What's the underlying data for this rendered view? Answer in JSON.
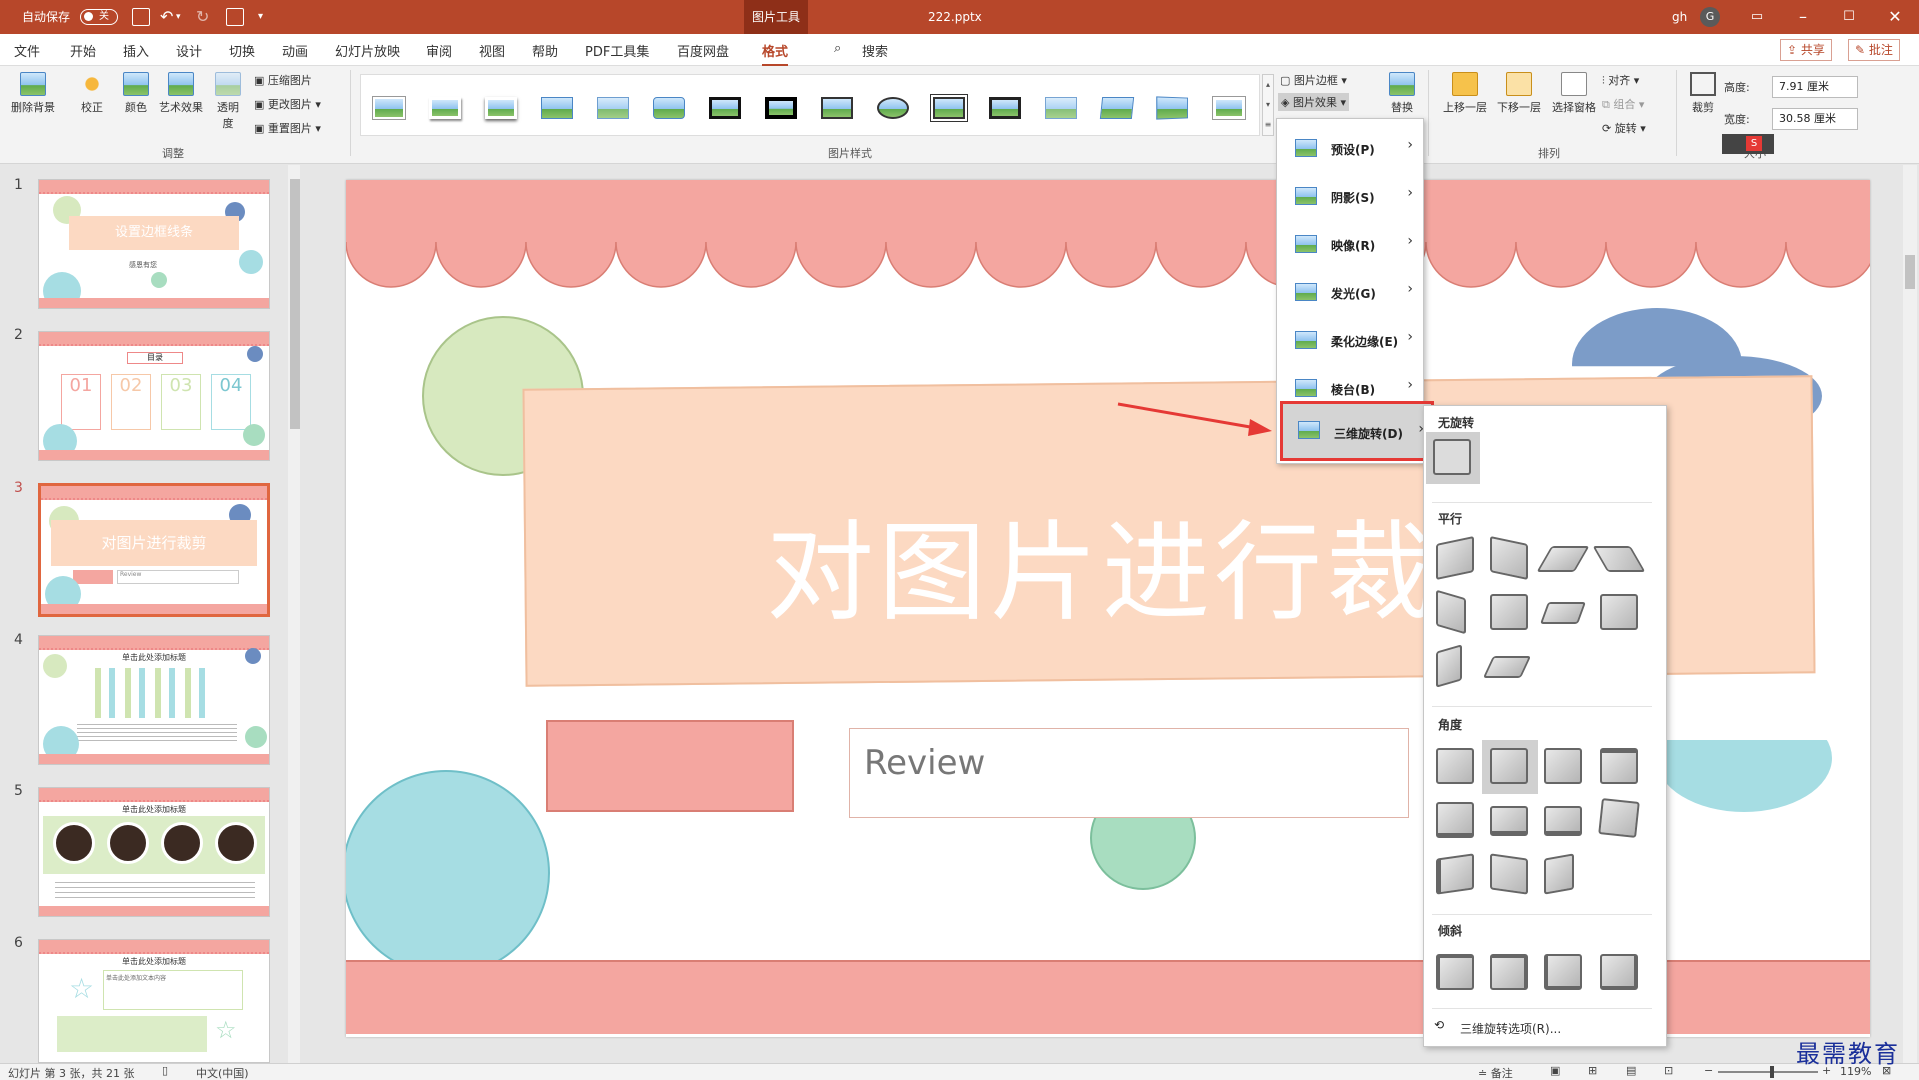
{
  "titlebar": {
    "autosave_label": "自动保存",
    "autosave_state": "关",
    "context_tab": "图片工具",
    "filename": "222.pptx",
    "user": "gh",
    "avatar_letter": "G"
  },
  "menu": {
    "items": [
      "文件",
      "开始",
      "插入",
      "设计",
      "切换",
      "动画",
      "幻灯片放映",
      "审阅",
      "视图",
      "帮助",
      "PDF工具集",
      "百度网盘",
      "格式"
    ],
    "active": "格式",
    "search": "搜索",
    "share": "共享",
    "comment": "批注"
  },
  "ribbon": {
    "remove_bg": "删除背景",
    "correct": "校正",
    "color": "颜色",
    "artistic": "艺术效果",
    "transparency": "透明度",
    "compress": "压缩图片",
    "change": "更改图片",
    "reset": "重置图片",
    "group_adjust": "调整",
    "group_styles": "图片样式",
    "pic_border": "图片边框",
    "pic_effects": "图片效果",
    "replace": "替换",
    "bring_forward": "上移一层",
    "send_backward": "下移一层",
    "selection_pane": "选择窗格",
    "align": "对齐",
    "group": "组合",
    "rotate": "旋转",
    "group_arrange": "排列",
    "crop": "裁剪",
    "height_label": "高度:",
    "height_value": "7.91 厘米",
    "width_label": "宽度:",
    "width_value": "30.58 厘米",
    "group_size": "大小"
  },
  "effects_menu": [
    {
      "label": "预设(P)"
    },
    {
      "label": "阴影(S)"
    },
    {
      "label": "映像(R)"
    },
    {
      "label": "发光(G)"
    },
    {
      "label": "柔化边缘(E)"
    },
    {
      "label": "棱台(B)"
    },
    {
      "label": "三维旋转(D)"
    }
  ],
  "rotation_submenu": {
    "none": "无旋转",
    "parallel": "平行",
    "perspective_angle": "角度",
    "oblique": "倾斜",
    "options": "三维旋转选项(R)..."
  },
  "slides": [
    {
      "num": "1",
      "title": "设置边框线条",
      "sub": "感恩有您"
    },
    {
      "num": "2",
      "title": "目录",
      "items": [
        "01",
        "02",
        "03",
        "04"
      ]
    },
    {
      "num": "3",
      "title": "对图片进行裁剪",
      "sub": "Review"
    },
    {
      "num": "4",
      "title": "单击此处添加标题"
    },
    {
      "num": "5",
      "title": "单击此处添加标题"
    },
    {
      "num": "6",
      "title": "单击此处添加标题",
      "sub": "单击此处添加文本内容"
    }
  ],
  "canvas": {
    "title": "对图片进行裁剪",
    "subtitle": "Review"
  },
  "status": {
    "slide_info": "幻灯片 第 3 张，共 21 张",
    "language": "中文(中国)",
    "notes": "备注",
    "zoom": "119%"
  },
  "watermark": "最需教育",
  "colors": {
    "accent": "#b7472a",
    "highlight": "#e53935"
  }
}
